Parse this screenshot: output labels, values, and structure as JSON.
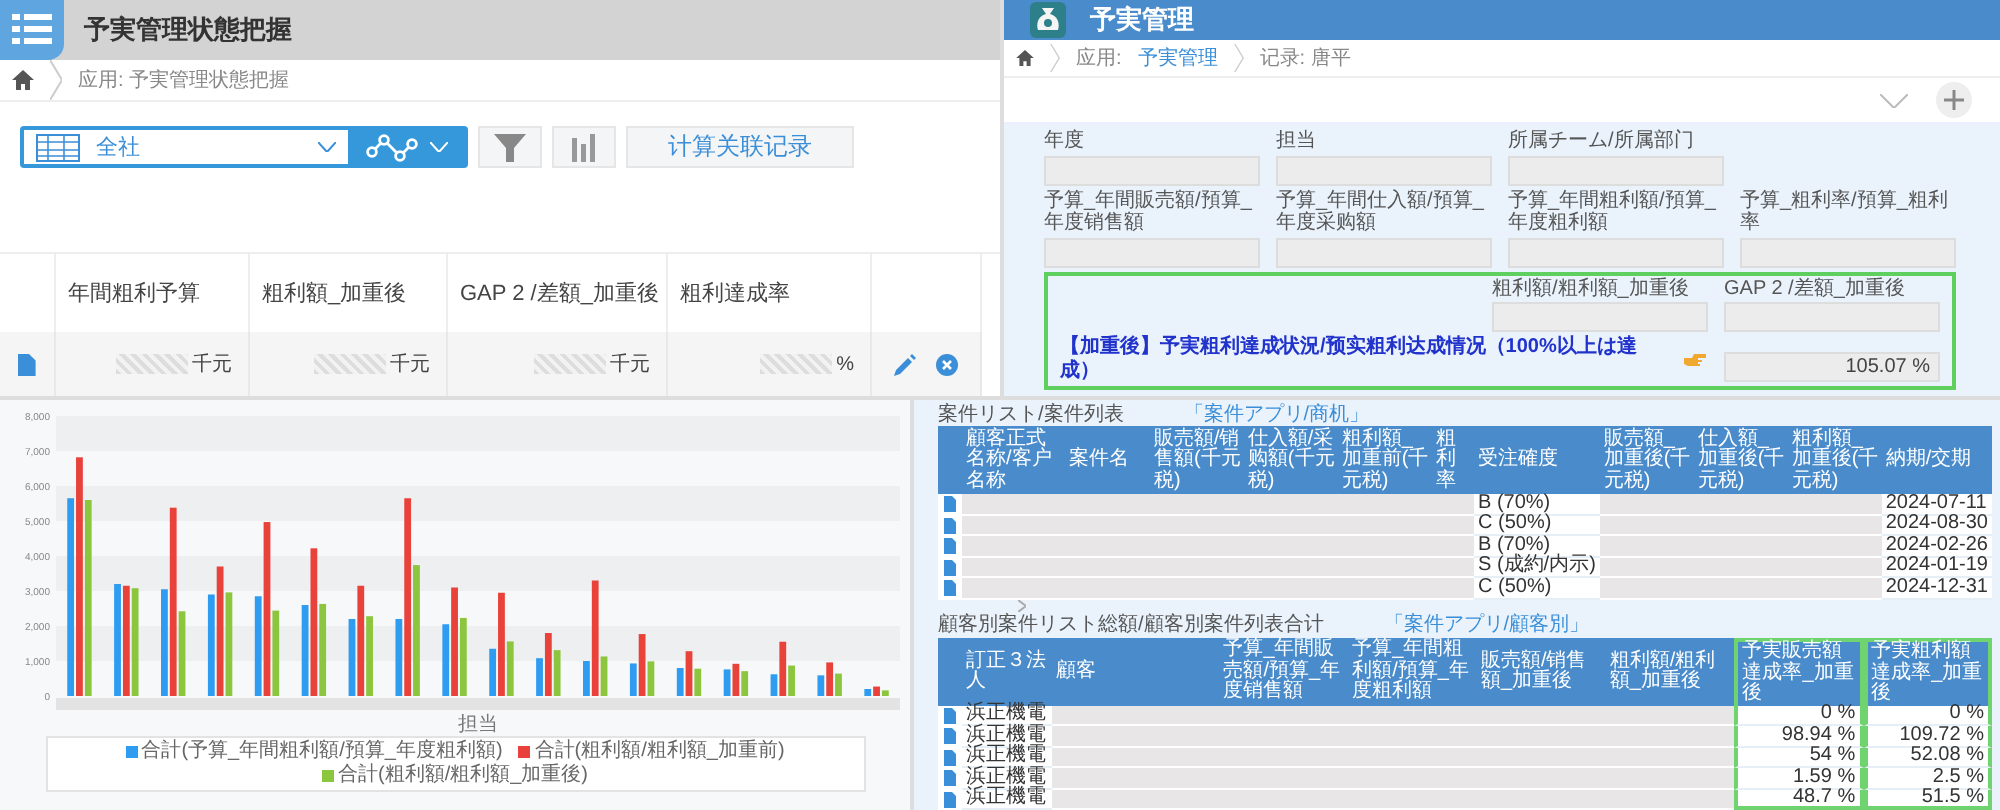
{
  "list_view": {
    "app_title": "予実管理状態把握",
    "breadcrumb": "应用: 予実管理状態把握",
    "view_select": "全社",
    "action_button": "计算关联记录",
    "columns": [
      "年間粗利予算",
      "粗利額_加重後",
      "GAP 2 /差額_加重後",
      "粗利達成率"
    ],
    "row": [
      "千元",
      "千元",
      "千元",
      "%"
    ]
  },
  "record_view": {
    "app_title": "予実管理",
    "breadcrumb": [
      {
        "label": "应用:",
        "link": "予実管理"
      },
      {
        "label": "记录: 唐平"
      }
    ],
    "fields": [
      {
        "label": "年度"
      },
      {
        "label": "担当"
      },
      {
        "label": "所属チーム/所属部门"
      },
      {
        "label": "予算_年間販売額/預算_年度销售額"
      },
      {
        "label": "予算_年間仕入額/預算_年度采购額"
      },
      {
        "label": "予算_年間粗利額/預算_年度粗利額"
      },
      {
        "label": "予算_粗利率/預算_粗利率"
      }
    ],
    "highlight": {
      "highlighted": true,
      "fields": [
        {
          "label": "粗利額/粗利額_加重後"
        },
        {
          "label": "GAP 2 /差額_加重後"
        }
      ],
      "note": "【加重後】予実粗利達成状況/预实粗利达成情况（100%以上は達成）",
      "value": "105.07 %"
    }
  },
  "chart_panel": {
    "chart_data": {
      "type": "bar",
      "xlabel": "担当",
      "ylim": [
        0,
        8000
      ],
      "yticks": [
        {
          "value": 0,
          "label": "0"
        },
        {
          "value": 1000,
          "label": "1,000"
        },
        {
          "value": 2000,
          "label": "2,000"
        },
        {
          "value": 3000,
          "label": "3,000"
        },
        {
          "value": 4000,
          "label": "4,000"
        },
        {
          "value": 5000,
          "label": "5,000"
        },
        {
          "value": 6000,
          "label": "6,000"
        },
        {
          "value": 7000,
          "label": "7,000"
        },
        {
          "value": 8000,
          "label": "8,000"
        }
      ],
      "series": [
        {
          "name": "合計(予算_年間粗利額/預算_年度粗利額)",
          "color": "#2e9cf0",
          "values": [
            5650,
            3200,
            3050,
            2900,
            2850,
            2600,
            2200,
            2200,
            2050,
            1350,
            1080,
            1000,
            930,
            800,
            760,
            620,
            590,
            200
          ]
        },
        {
          "name": "合計(粗利額/粗利額_加重前)",
          "color": "#e8423a",
          "values": [
            6820,
            3150,
            5380,
            3700,
            4970,
            4220,
            3150,
            5650,
            3100,
            2950,
            1800,
            3300,
            1770,
            1280,
            920,
            1550,
            960,
            270
          ]
        },
        {
          "name": "合計(粗利額/粗利額_加重後)",
          "color": "#8cc63f",
          "values": [
            5600,
            3080,
            2420,
            2960,
            2440,
            2630,
            2280,
            3740,
            2230,
            1560,
            1310,
            1130,
            990,
            780,
            710,
            870,
            640,
            160
          ]
        }
      ]
    }
  },
  "related_lists": [
    {
      "title": "案件リスト/案件列表",
      "link": "「案件アプリ/商机」",
      "columns": [
        {
          "label": "顧客正式名称/客户名称",
          "kind": "redacted"
        },
        {
          "label": "案件名",
          "kind": "redacted"
        },
        {
          "label": "販売額/销售額(千元税)",
          "kind": "redacted"
        },
        {
          "label": "仕入額/采购額(千元税)",
          "kind": "redacted"
        },
        {
          "label": "粗利額_加重前(千元税)",
          "kind": "redacted"
        },
        {
          "label": "粗利率",
          "kind": "redacted"
        },
        {
          "label": "受注確度",
          "kind": "text"
        },
        {
          "label": "販売額_加重後(千元税)",
          "kind": "redacted"
        },
        {
          "label": "仕入額_加重後(千元税)",
          "kind": "redacted"
        },
        {
          "label": "粗利額_加重後(千元税)",
          "kind": "redacted"
        },
        {
          "label": "納期/交期",
          "kind": "text"
        }
      ],
      "rows": [
        [
          "B (70%)",
          "2024-07-11"
        ],
        [
          "C (50%)",
          "2024-08-30"
        ],
        [
          "B (70%)",
          "2024-02-26"
        ],
        [
          "S (成約/内示)",
          "2024-01-19"
        ],
        [
          "C (50%)",
          "2024-12-31"
        ]
      ]
    },
    {
      "title": "顧客別案件リスト総額/顧客別案件列表合计",
      "link": "「案件アプリ/顧客別」",
      "columns": [
        {
          "label": "訂正３法人",
          "kind": "text"
        },
        {
          "label": "顧客",
          "kind": "redacted"
        },
        {
          "label": "予算_年間販売額/預算_年度销售額",
          "kind": "redacted"
        },
        {
          "label": "予算_年間粗利額/預算_年度粗利額",
          "kind": "redacted"
        },
        {
          "label": "販売額/销售額_加重後",
          "kind": "redacted"
        },
        {
          "label": "粗利額/粗利額_加重後",
          "kind": "redacted"
        },
        {
          "label": "予実販売額達成率_加重後",
          "kind": "text",
          "highlighted": true
        },
        {
          "label": "予実粗利額達成率_加重後",
          "kind": "text",
          "highlighted": true
        }
      ],
      "rows": [
        [
          "浜正機電",
          "0 %",
          "0 %"
        ],
        [
          "浜正機電",
          "98.94 %",
          "109.72 %"
        ],
        [
          "浜正機電",
          "54 %",
          "52.08 %"
        ],
        [
          "浜正機電",
          "1.59 %",
          "2.5 %"
        ],
        [
          "浜正機電",
          "48.7 %",
          "51.5 %"
        ]
      ]
    }
  ]
}
